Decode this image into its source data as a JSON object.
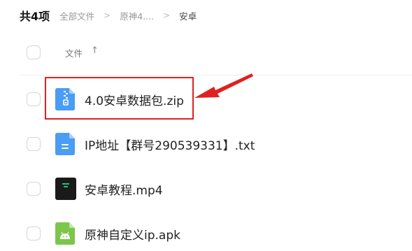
{
  "header": {
    "count_label": "共4项",
    "breadcrumbs": [
      "全部文件",
      "原神4....",
      "安卓"
    ],
    "separator": ">"
  },
  "table": {
    "column_name": "文件",
    "sort_icon": "↑"
  },
  "files": [
    {
      "name": "4.0安卓数据包.zip",
      "icon": "zip-file-icon",
      "highlighted": true
    },
    {
      "name": "IP地址【群号290539331】.txt",
      "icon": "txt-file-icon",
      "highlighted": false
    },
    {
      "name": "安卓教程.mp4",
      "icon": "video-file-icon",
      "highlighted": false
    },
    {
      "name": "原神自定义ip.apk",
      "icon": "apk-file-icon",
      "highlighted": false
    }
  ],
  "colors": {
    "highlight": "#e02020",
    "zip_icon": "#4a9cf5",
    "txt_icon": "#4a9cf5",
    "video_icon": "#1a1a1a",
    "apk_icon": "#7cc64b"
  }
}
